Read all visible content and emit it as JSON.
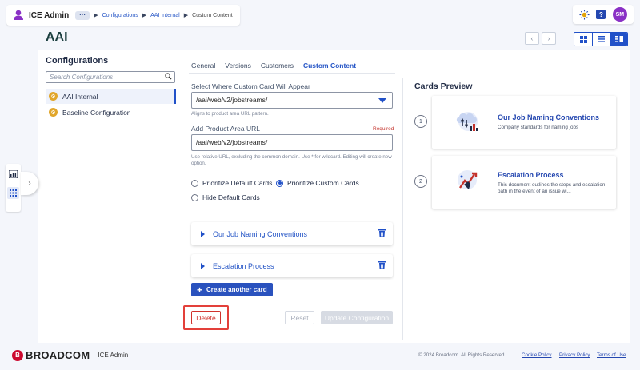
{
  "header": {
    "app_title": "ICE Admin",
    "more_label": "···",
    "breadcrumbs": [
      "Configurations",
      "AAI Internal",
      "Custom Content"
    ],
    "avatar_initials": "SM",
    "help_label": "?"
  },
  "page_title": "AAI",
  "sidebar": {
    "title": "Configurations",
    "search_placeholder": "Search Configurations",
    "items": [
      {
        "label": "AAI Internal",
        "active": true
      },
      {
        "label": "Baseline Configuration",
        "active": false
      }
    ]
  },
  "tabs": [
    {
      "label": "General",
      "active": false
    },
    {
      "label": "Versions",
      "active": false
    },
    {
      "label": "Customers",
      "active": false
    },
    {
      "label": "Custom Content",
      "active": true
    }
  ],
  "form": {
    "location_label": "Select Where Custom Card Will Appear",
    "location_value": "/aai/web/v2/jobstreams/",
    "location_help": "Aligns to product area URL pattern.",
    "url_label": "Add Product Area URL",
    "url_required": "Required",
    "url_value": "/aai/web/v2/jobstreams/",
    "url_help": "Use relative URL, excluding the common domain. Use * for wildcard. Editing will create new option.",
    "radio_options": [
      {
        "label": "Prioritize Default Cards",
        "selected": false
      },
      {
        "label": "Prioritize Custom Cards",
        "selected": true
      },
      {
        "label": "Hide Default Cards",
        "selected": false
      }
    ],
    "accordion": [
      {
        "label": "Our Job Naming Conventions"
      },
      {
        "label": "Escalation Process"
      }
    ],
    "create_label": "Create another card",
    "delete_label": "Delete",
    "reset_label": "Reset",
    "update_label": "Update Configuration"
  },
  "preview": {
    "title": "Cards Preview",
    "cards": [
      {
        "number": "1",
        "title": "Our Job Naming Conventions",
        "description": "Company standards for naming jobs"
      },
      {
        "number": "2",
        "title": "Escalation Process",
        "description": "This document outlines the steps and escalation path in the event of an issue wi..."
      }
    ]
  },
  "footer": {
    "brand": "BROADCOM",
    "brand_mark": "B",
    "app": "ICE Admin",
    "copyright": "© 2024 Broadcom. All Rights Reserved.",
    "links": [
      "Cookie Policy",
      "Privacy Policy",
      "Terms of Use"
    ]
  },
  "colors": {
    "accent": "#2151c8",
    "danger": "#d0322d",
    "brand_red": "#cc092f"
  }
}
